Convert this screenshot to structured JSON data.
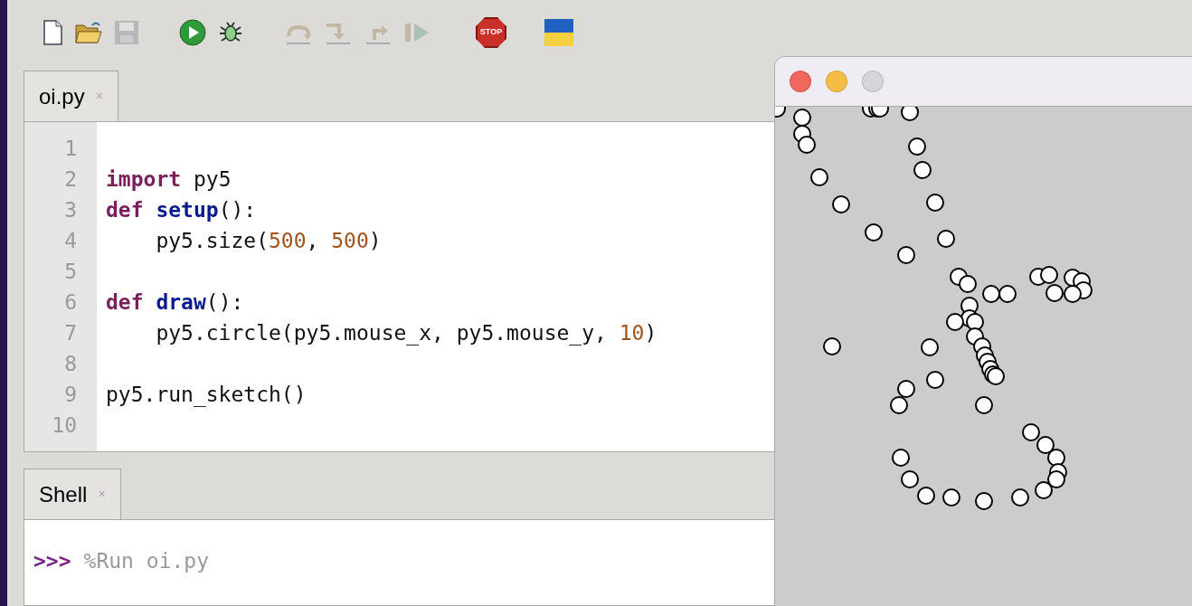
{
  "toolbar": [
    {
      "kind": "new",
      "disabled": false
    },
    {
      "kind": "open",
      "disabled": false
    },
    {
      "kind": "save",
      "disabled": true
    },
    {
      "kind": "run",
      "disabled": false
    },
    {
      "kind": "debug",
      "disabled": false
    },
    {
      "kind": "step_over",
      "disabled": true
    },
    {
      "kind": "step_into",
      "disabled": true
    },
    {
      "kind": "step_out",
      "disabled": true
    },
    {
      "kind": "resume",
      "disabled": true
    },
    {
      "kind": "stop",
      "disabled": false,
      "label": "STOP"
    },
    {
      "kind": "flag",
      "disabled": false
    }
  ],
  "editor": {
    "tabs": [
      {
        "label": "oi.py",
        "close": "×",
        "selected": true
      }
    ],
    "lines": [
      {
        "number": "1"
      },
      {
        "number": "2",
        "tokens": [
          {
            "kind": "keyword",
            "text": "import"
          },
          {
            "kind": "plain",
            "text": " py5"
          }
        ]
      },
      {
        "number": "3",
        "tokens": [
          {
            "kind": "keyword",
            "text": "def "
          },
          {
            "kind": "name",
            "text": "setup"
          },
          {
            "kind": "plain",
            "text": "():"
          }
        ]
      },
      {
        "number": "4",
        "tokens": [
          {
            "kind": "plain",
            "text": "    py5.size("
          },
          {
            "kind": "number",
            "text": "500"
          },
          {
            "kind": "plain",
            "text": ", "
          },
          {
            "kind": "number",
            "text": "500"
          },
          {
            "kind": "plain",
            "text": ")"
          }
        ]
      },
      {
        "number": "5"
      },
      {
        "number": "6",
        "tokens": [
          {
            "kind": "keyword",
            "text": "def "
          },
          {
            "kind": "name",
            "text": "draw"
          },
          {
            "kind": "plain",
            "text": "():"
          }
        ]
      },
      {
        "number": "7",
        "tokens": [
          {
            "kind": "plain",
            "text": "    py5.circle(py5.mouse_x, py5.mouse_y, "
          },
          {
            "kind": "number",
            "text": "10"
          },
          {
            "kind": "plain",
            "text": ")"
          }
        ]
      },
      {
        "number": "8"
      },
      {
        "number": "9",
        "tokens": [
          {
            "kind": "plain",
            "text": "py5.run_sketch()"
          }
        ]
      },
      {
        "number": "10"
      }
    ]
  },
  "shell": {
    "tabs": [
      {
        "label": "Shell",
        "close": "×",
        "selected": true
      }
    ],
    "prompt": ">>>",
    "command": "%Run oi.py"
  }
}
